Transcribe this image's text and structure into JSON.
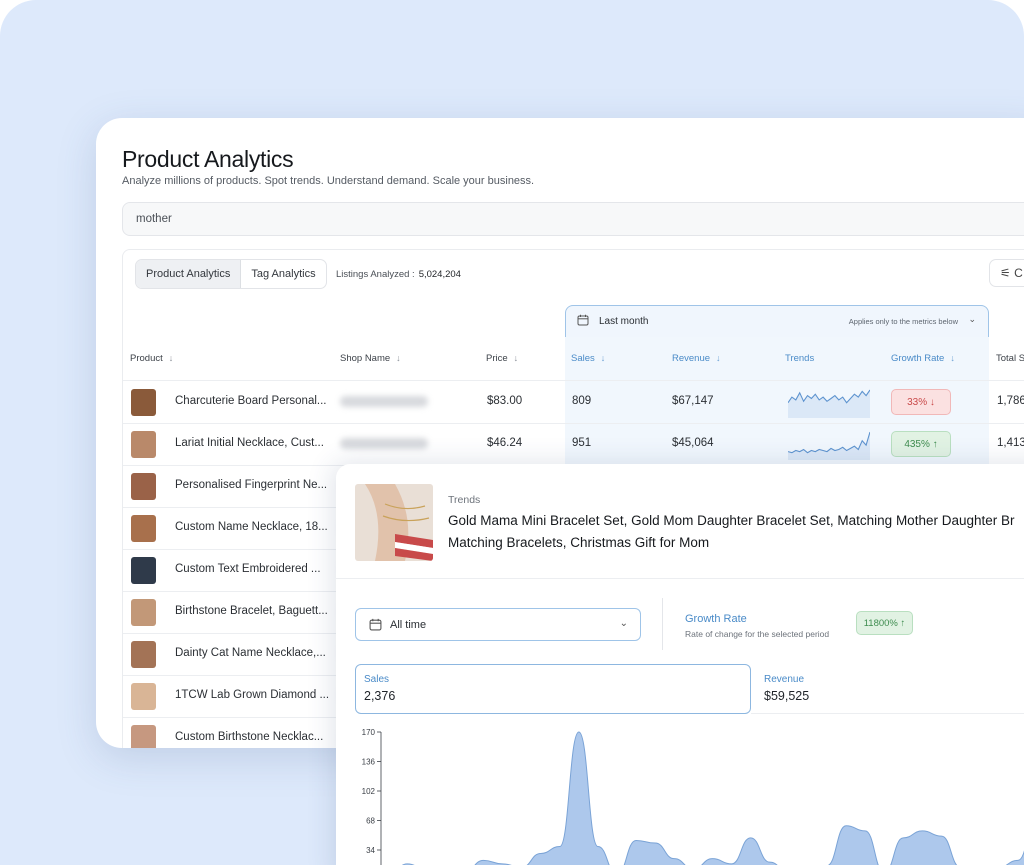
{
  "header": {
    "title": "Product Analytics",
    "subtitle": "Analyze millions of products. Spot trends. Understand demand. Scale your business."
  },
  "search": {
    "value": "mother"
  },
  "toolbar": {
    "tabs": [
      {
        "label": "Product Analytics",
        "active": true
      },
      {
        "label": "Tag Analytics",
        "active": false
      }
    ],
    "listings_label": "Listings Analyzed :",
    "listings_value": "5,024,204",
    "filter_label": "C"
  },
  "date_filter": {
    "label": "Last month",
    "note": "Applies only to the metrics below"
  },
  "table": {
    "columns": {
      "product": "Product",
      "shop": "Shop Name",
      "price": "Price",
      "sales": "Sales",
      "revenue": "Revenue",
      "trends": "Trends",
      "growth": "Growth Rate",
      "total": "Total S"
    },
    "rows": [
      {
        "name": "Charcuterie Board Personal...",
        "price": "$83.00",
        "sales": "809",
        "revenue": "$67,147",
        "growth": "33% ↓",
        "growth_dir": "down",
        "total": "1,786",
        "thumb": "#8a5a3a",
        "spark": [
          8,
          12,
          10,
          15,
          9,
          13,
          11,
          14,
          10,
          12,
          9,
          11,
          13,
          10,
          12,
          8,
          11,
          14,
          12,
          16,
          13,
          17
        ]
      },
      {
        "name": "Lariat Initial Necklace, Cust...",
        "price": "$46.24",
        "sales": "951",
        "revenue": "$45,064",
        "growth": "435% ↑",
        "growth_dir": "up",
        "total": "1,413",
        "thumb": "#b9896a",
        "spark": [
          4,
          3,
          5,
          4,
          6,
          3,
          5,
          4,
          6,
          5,
          4,
          7,
          5,
          6,
          8,
          5,
          7,
          9,
          6,
          14,
          10,
          22
        ]
      },
      {
        "name": "Personalised Fingerprint Ne...",
        "thumb": "#9a6248"
      },
      {
        "name": "Custom Name Necklace, 18...",
        "thumb": "#a8704c"
      },
      {
        "name": "Custom Text Embroidered ...",
        "thumb": "#2f3a4a"
      },
      {
        "name": "Birthstone Bracelet, Baguett...",
        "thumb": "#c29878"
      },
      {
        "name": "Dainty Cat Name Necklace,...",
        "thumb": "#a37356"
      },
      {
        "name": "1TCW Lab Grown Diamond ...",
        "thumb": "#d9b596"
      },
      {
        "name": "Custom Birthstone Necklac...",
        "thumb": "#c69880"
      }
    ]
  },
  "trend_panel": {
    "label": "Trends",
    "title_line1": "Gold Mama Mini Bracelet Set, Gold Mom Daughter Bracelet Set, Matching Mother Daughter Br",
    "title_line2": "Matching Bracelets, Christmas Gift for Mom",
    "range_label": "All time",
    "growth_label": "Growth Rate",
    "growth_sub": "Rate of change for the selected period",
    "growth_value": "11800% ↑",
    "sales_label": "Sales",
    "sales_value": "2,376",
    "revenue_label": "Revenue",
    "revenue_value": "$59,525"
  },
  "chart_data": {
    "type": "area",
    "yticks": [
      "170",
      "136",
      "102",
      "68",
      "34"
    ],
    "ylim": [
      0,
      170
    ],
    "values": [
      2,
      18,
      12,
      16,
      8,
      22,
      18,
      14,
      30,
      38,
      170,
      38,
      6,
      45,
      42,
      24,
      12,
      24,
      18,
      48,
      20,
      8,
      6,
      16,
      62,
      56,
      8,
      48,
      56,
      50,
      14,
      2,
      14,
      22,
      72,
      100
    ],
    "color": "#adc8ec",
    "line_color": "#7aa3d6"
  }
}
